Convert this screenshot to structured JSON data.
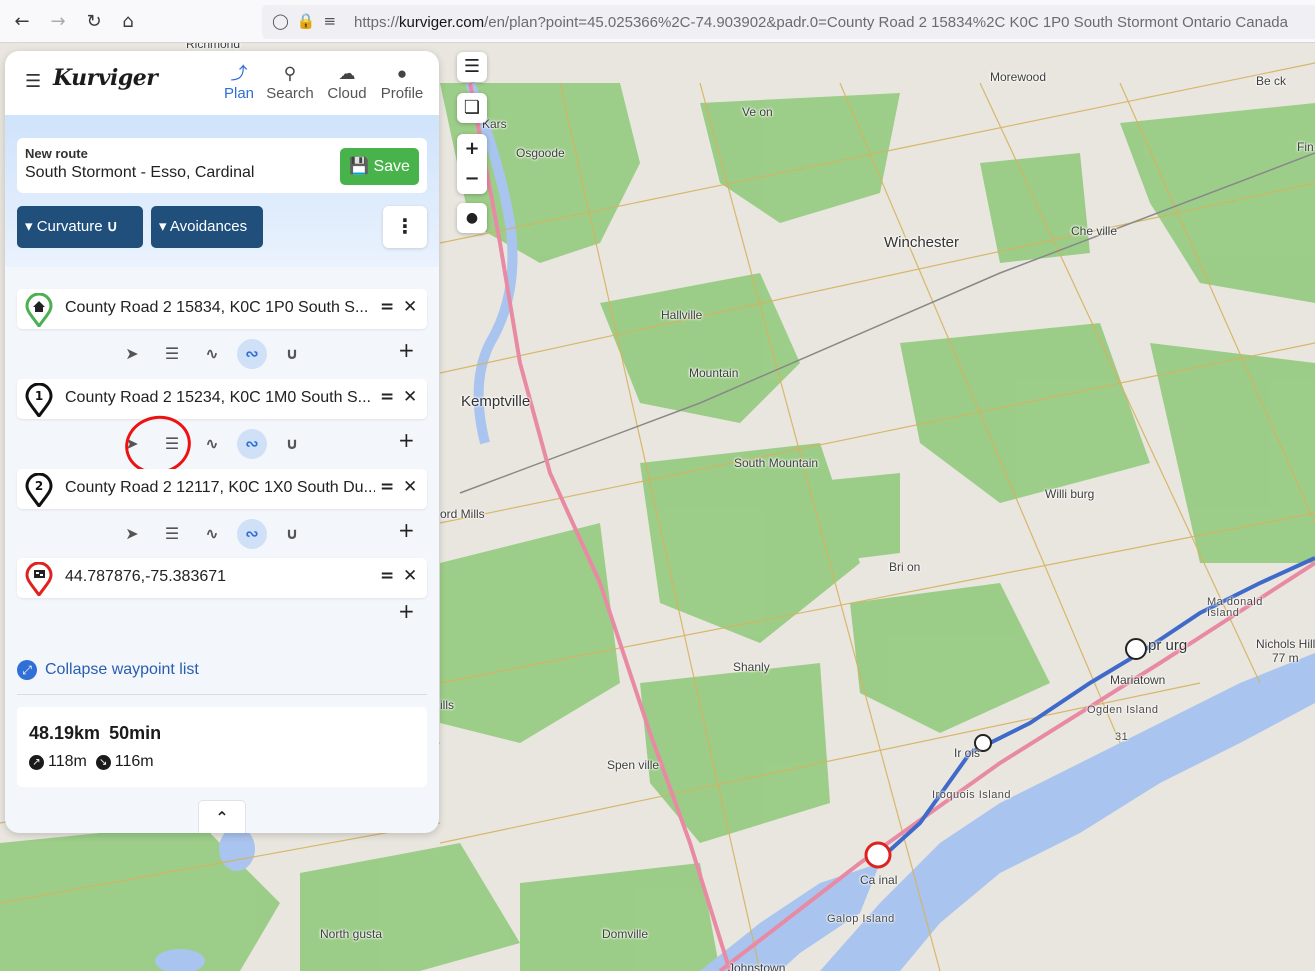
{
  "browser": {
    "url_prefix": "https://",
    "url_domain": "kurviger.com",
    "url_rest": "/en/plan?point=45.025366%2C-74.903902&padr.0=County Road 2 15834%2C K0C 1P0 South Stormont Ontario Canada",
    "back_icon": "arrow-left-icon",
    "forward_icon": "arrow-right-icon",
    "reload_icon": "reload-icon",
    "home_icon": "home-icon"
  },
  "app": {
    "logo": "Kurviger",
    "nav": [
      {
        "label": "Plan",
        "icon": "plan-icon",
        "active": true
      },
      {
        "label": "Search",
        "icon": "search-icon"
      },
      {
        "label": "Cloud",
        "icon": "cloud-icon"
      },
      {
        "label": "Profile",
        "icon": "profile-icon"
      }
    ]
  },
  "route": {
    "label": "New route",
    "name": "South Stormont - Esso, Cardinal",
    "save_label": "Save",
    "curvature_label": "Curvature",
    "avoidances_label": "Avoidances"
  },
  "waypoints": [
    {
      "text": "County Road 2 15834, K0C 1P0 South S...",
      "marker": "home"
    },
    {
      "text": "County Road 2 15234, K0C 1M0 South S...",
      "marker": "1"
    },
    {
      "text": "County Road 2 12117, K0C 1X0 South Du...",
      "marker": "2"
    },
    {
      "text": "44.787876,-75.383671",
      "marker": "finish"
    }
  ],
  "collapse_label": "Collapse waypoint list",
  "summary": {
    "distance": "48.19km",
    "duration": "50min",
    "ascent": "118m",
    "descent": "116m"
  },
  "map": {
    "places": [
      {
        "name": "Richmond",
        "cls": "mid"
      },
      {
        "name": "Kars",
        "cls": "mid"
      },
      {
        "name": "Osgoode",
        "cls": "mid"
      },
      {
        "name": "Ve  on",
        "cls": "mid"
      },
      {
        "name": "Morewood",
        "cls": "mid"
      },
      {
        "name": "Be  ck",
        "cls": "mid"
      },
      {
        "name": "Fin",
        "cls": "mid"
      },
      {
        "name": "Winchester",
        "cls": "big"
      },
      {
        "name": "Che   ville",
        "cls": "mid"
      },
      {
        "name": "Hallville",
        "cls": "mid"
      },
      {
        "name": "Mountain",
        "cls": "mid"
      },
      {
        "name": "Kemptville",
        "cls": "big"
      },
      {
        "name": "South Mountain",
        "cls": "mid"
      },
      {
        "name": "Willi  burg",
        "cls": "mid"
      },
      {
        "name": "ord Mills",
        "cls": "mid"
      },
      {
        "name": "Bri  on",
        "cls": "mid"
      },
      {
        "name": "Ma donald Island",
        "cls": "small"
      },
      {
        "name": "Nichols Hill",
        "cls": "mid"
      },
      {
        "name": "77 m",
        "cls": "mid"
      },
      {
        "name": "pr   urg",
        "cls": "big"
      },
      {
        "name": "Mariatown",
        "cls": "mid"
      },
      {
        "name": "Ogden Island",
        "cls": "small"
      },
      {
        "name": "Shanly",
        "cls": "mid"
      },
      {
        "name": "ills",
        "cls": "mid"
      },
      {
        "name": "Ir    ois",
        "cls": "mid"
      },
      {
        "name": "Iroquois Island",
        "cls": "small"
      },
      {
        "name": "Spen   ville",
        "cls": "mid"
      },
      {
        "name": "Ca  inal",
        "cls": "mid"
      },
      {
        "name": "Galop Island",
        "cls": "small"
      },
      {
        "name": "North  gusta",
        "cls": "mid"
      },
      {
        "name": "Domville",
        "cls": "mid"
      },
      {
        "name": "Johnstown",
        "cls": "mid"
      },
      {
        "name": "31",
        "cls": "small"
      }
    ]
  }
}
